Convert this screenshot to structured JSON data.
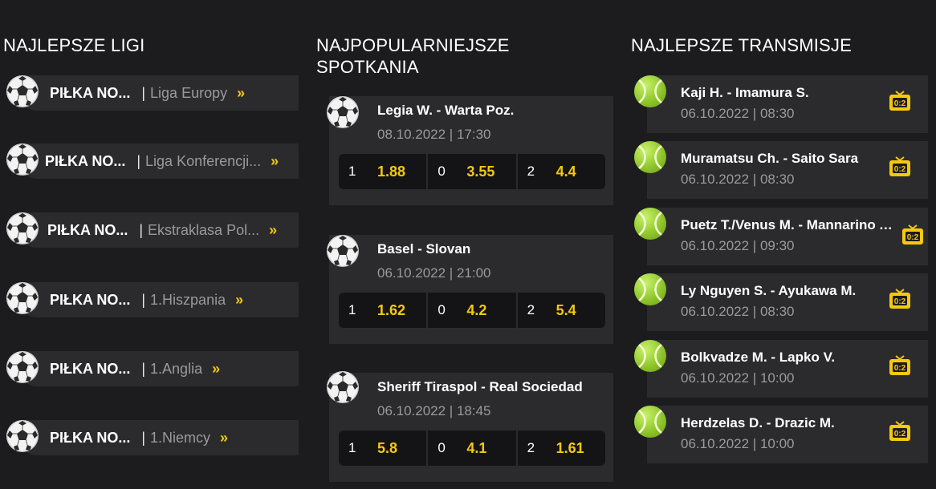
{
  "leagues": {
    "title": "NAJLEPSZE LIGI",
    "items": [
      {
        "sport": "PIŁKA NO...",
        "sep": "|",
        "league": "Liga Europy",
        "chevron": "»",
        "icon": "soccer-ball-icon"
      },
      {
        "sport": "PIŁKA NO...",
        "sep": "|",
        "league": "Liga Konferencji...",
        "chevron": "»",
        "icon": "soccer-ball-icon"
      },
      {
        "sport": "PIŁKA NO...",
        "sep": "|",
        "league": "Ekstraklasa Pol...",
        "chevron": "»",
        "icon": "soccer-ball-icon"
      },
      {
        "sport": "PIŁKA NO...",
        "sep": "|",
        "league": "1.Hiszpania",
        "chevron": "»",
        "icon": "soccer-ball-icon"
      },
      {
        "sport": "PIŁKA NO...",
        "sep": "|",
        "league": "1.Anglia",
        "chevron": "»",
        "icon": "soccer-ball-icon"
      },
      {
        "sport": "PIŁKA NO...",
        "sep": "|",
        "league": "1.Niemcy",
        "chevron": "»",
        "icon": "soccer-ball-icon"
      }
    ]
  },
  "matches": {
    "title": "NAJPOPULARNIEJSZE SPOTKANIA",
    "items": [
      {
        "teams": "Legia W. - Warta Poz.",
        "time": "08.10.2022 | 17:30",
        "odds": [
          {
            "label": "1",
            "value": "1.88"
          },
          {
            "label": "0",
            "value": "3.55"
          },
          {
            "label": "2",
            "value": "4.4"
          }
        ]
      },
      {
        "teams": "Basel - Slovan",
        "time": "06.10.2022 | 21:00",
        "odds": [
          {
            "label": "1",
            "value": "1.62"
          },
          {
            "label": "0",
            "value": "4.2"
          },
          {
            "label": "2",
            "value": "5.4"
          }
        ]
      },
      {
        "teams": "Sheriff Tiraspol - Real Sociedad",
        "time": "06.10.2022 | 18:45",
        "odds": [
          {
            "label": "1",
            "value": "5.8"
          },
          {
            "label": "0",
            "value": "4.1"
          },
          {
            "label": "2",
            "value": "1.61"
          }
        ]
      }
    ]
  },
  "streams": {
    "title": "NAJLEPSZE TRANSMISJE",
    "items": [
      {
        "teams": "Kaji H. - Imamura S.",
        "time": "06.10.2022 | 08:30",
        "icon": "tennis-ball-icon"
      },
      {
        "teams": "Muramatsu Ch. - Saito Sara",
        "time": "06.10.2022 | 08:30",
        "icon": "tennis-ball-icon"
      },
      {
        "teams": "Puetz T./Venus M. - Mannarino A./Martin A.",
        "time": "06.10.2022 | 09:30",
        "icon": "tennis-ball-icon"
      },
      {
        "teams": "Ly Nguyen S. - Ayukawa M.",
        "time": "06.10.2022 | 08:30",
        "icon": "tennis-ball-icon"
      },
      {
        "teams": "Bolkvadze M. - Lapko V.",
        "time": "06.10.2022 | 10:00",
        "icon": "tennis-ball-icon"
      },
      {
        "teams": "Herdzelas D. - Drazic M.",
        "time": "06.10.2022 | 10:00",
        "icon": "tennis-ball-icon"
      }
    ]
  },
  "colors": {
    "background": "#1c1c1e",
    "card": "#2b2b2e",
    "odds_box": "#141416",
    "accent": "#f6c90e",
    "muted_text": "#9a9a9a"
  }
}
